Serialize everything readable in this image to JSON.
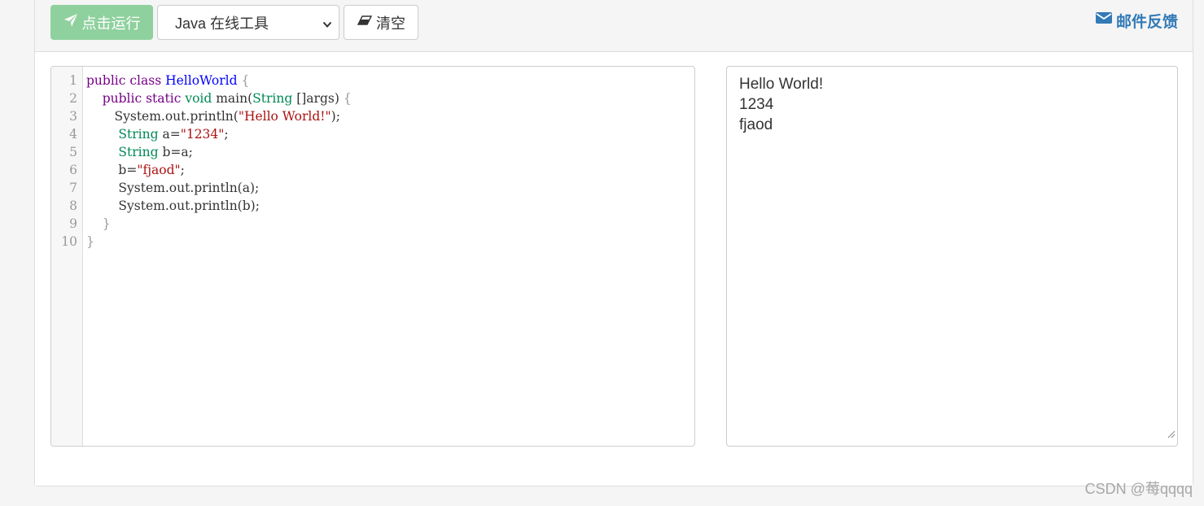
{
  "toolbar": {
    "run_label": "点击运行",
    "language_selected": "Java 在线工具",
    "clear_label": "清空",
    "feedback_label": "邮件反馈"
  },
  "editor": {
    "line_numbers": [
      "1",
      "2",
      "3",
      "4",
      "5",
      "6",
      "7",
      "8",
      "9",
      "10"
    ],
    "lines": [
      [
        {
          "t": "public",
          "c": "kw"
        },
        {
          "t": " "
        },
        {
          "t": "class",
          "c": "kw"
        },
        {
          "t": " "
        },
        {
          "t": "HelloWorld",
          "c": "def"
        },
        {
          "t": " {",
          "c": "punc"
        }
      ],
      [
        {
          "t": "    "
        },
        {
          "t": "public",
          "c": "kw"
        },
        {
          "t": " "
        },
        {
          "t": "static",
          "c": "kw"
        },
        {
          "t": " "
        },
        {
          "t": "void",
          "c": "ty"
        },
        {
          "t": " main("
        },
        {
          "t": "String",
          "c": "ty"
        },
        {
          "t": " []args) "
        },
        {
          "t": "{",
          "c": "punc"
        }
      ],
      [
        {
          "t": "       System.out.println("
        },
        {
          "t": "\"Hello World!\"",
          "c": "str"
        },
        {
          "t": ");"
        }
      ],
      [
        {
          "t": "        "
        },
        {
          "t": "String",
          "c": "ty"
        },
        {
          "t": " a="
        },
        {
          "t": "\"1234\"",
          "c": "str"
        },
        {
          "t": ";"
        }
      ],
      [
        {
          "t": "        "
        },
        {
          "t": "String",
          "c": "ty"
        },
        {
          "t": " b=a;"
        }
      ],
      [
        {
          "t": "        b="
        },
        {
          "t": "\"fjaod\"",
          "c": "str"
        },
        {
          "t": ";"
        }
      ],
      [
        {
          "t": "        System.out.println(a);"
        }
      ],
      [
        {
          "t": "        System.out.println(b);"
        }
      ],
      [
        {
          "t": "    "
        },
        {
          "t": "}",
          "c": "punc"
        }
      ],
      [
        {
          "t": "}",
          "c": "punc"
        }
      ]
    ]
  },
  "output": {
    "lines": [
      "Hello World!",
      "1234",
      "fjaod"
    ]
  },
  "watermark": "CSDN @莓qqqq",
  "colors": {
    "run_button_bg": "#8fd19e",
    "link_blue": "#337ab7",
    "keyword": "#770088",
    "type": "#008855",
    "definition": "#0000ff",
    "string": "#aa1111"
  },
  "icons": {
    "run": "paper-plane-icon",
    "clear": "eraser-icon",
    "feedback": "envelope-icon"
  }
}
